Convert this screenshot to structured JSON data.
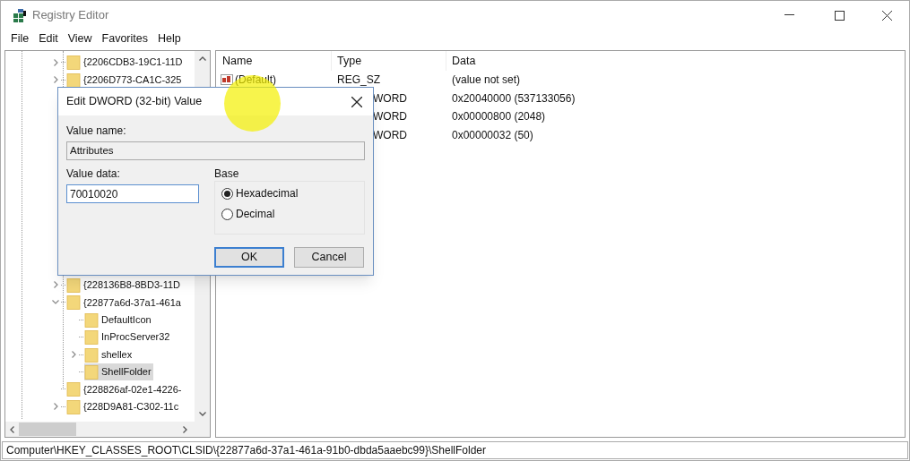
{
  "window": {
    "title": "Registry Editor"
  },
  "menu": [
    "File",
    "Edit",
    "View",
    "Favorites",
    "Help"
  ],
  "tree": {
    "items_top": [
      {
        "label": "{2206CDB3-19C1-11D",
        "expanded": false,
        "selected": false
      },
      {
        "label": "{2206D773-CA1C-325",
        "expanded": false,
        "selected": false
      }
    ],
    "items_bottom": [
      {
        "label": "{228136B8-8BD3-11D",
        "expanded": false,
        "selected": false
      },
      {
        "label": "{22877a6d-37a1-461a",
        "expanded": true,
        "selected": false,
        "children": [
          {
            "label": "DefaultIcon",
            "selected": false
          },
          {
            "label": "InProcServer32",
            "selected": false
          },
          {
            "label": "shellex",
            "expanded": false,
            "selected": false
          },
          {
            "label": "ShellFolder",
            "selected": true
          }
        ]
      },
      {
        "label": "{228826af-02e1-4226-",
        "selected": false
      },
      {
        "label": "{228D9A81-C302-11c",
        "expanded": false,
        "selected": false
      }
    ]
  },
  "list": {
    "columns": [
      "Name",
      "Type",
      "Data"
    ],
    "rows": [
      {
        "name": "(Default)",
        "type": "REG_SZ",
        "data": "(value not set)"
      },
      {
        "type": "WORD",
        "data": "0x20040000 (537133056)"
      },
      {
        "type": "WORD",
        "data": "0x00000800 (2048)"
      },
      {
        "type": "WORD",
        "data": "0x00000032 (50)"
      }
    ]
  },
  "dialog": {
    "title": "Edit DWORD (32-bit) Value",
    "value_name_label": "Value name:",
    "value_name": "Attributes",
    "value_data_label": "Value data:",
    "value_data": "70010020",
    "base_label": "Base",
    "base_options": [
      {
        "label": "Hexadecimal",
        "selected": true
      },
      {
        "label": "Decimal",
        "selected": false
      }
    ],
    "buttons": [
      {
        "label": "OK",
        "default": true
      },
      {
        "label": "Cancel",
        "default": false
      }
    ]
  },
  "status_bar": "Computer\\HKEY_CLASSES_ROOT\\CLSID\\{22877a6d-37a1-461a-91b0-dbda5aaebc99}\\ShellFolder"
}
